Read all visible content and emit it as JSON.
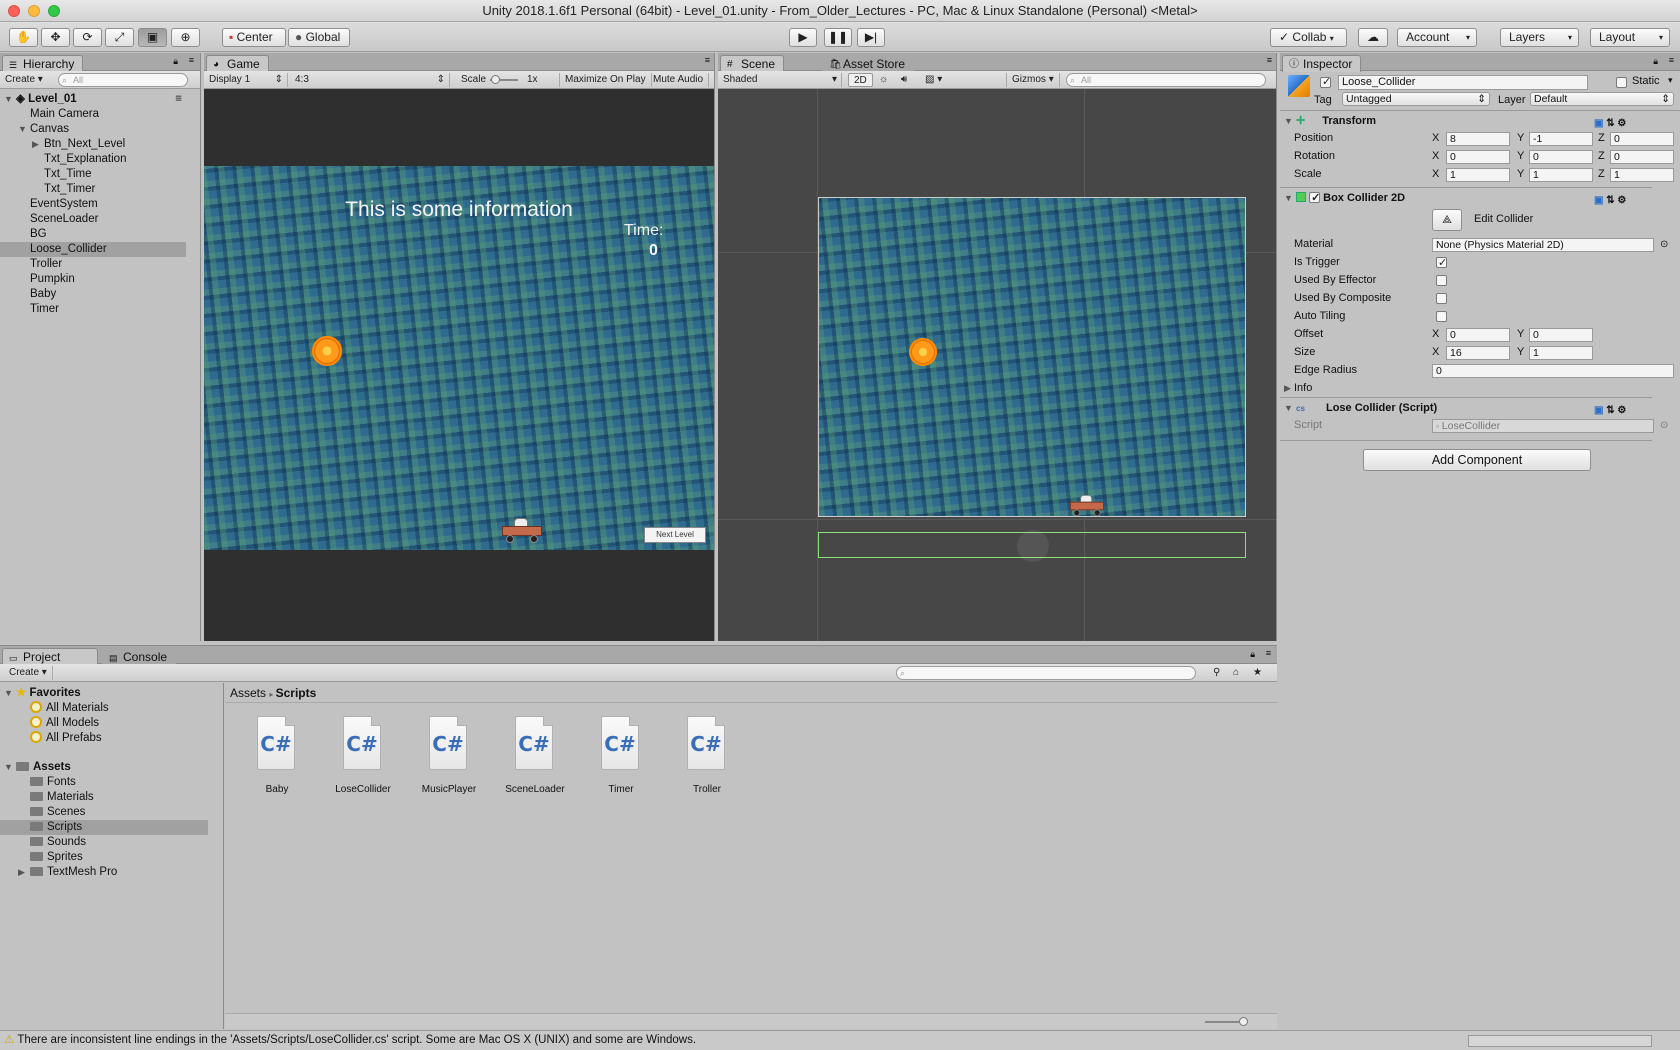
{
  "window": {
    "title": "Unity 2018.1.6f1 Personal (64bit) - Level_01.unity - From_Older_Lectures - PC, Mac & Linux Standalone (Personal) <Metal>"
  },
  "toolbar": {
    "center_label": "Center",
    "global_label": "Global",
    "collab_label": "Collab",
    "account_label": "Account",
    "layers_label": "Layers",
    "layout_label": "Layout"
  },
  "hierarchy": {
    "tab": "Hierarchy",
    "create": "Create",
    "search_placeholder": "All",
    "scene": "Level_01",
    "items": [
      "Main Camera",
      "Canvas",
      "Btn_Next_Level",
      "Txt_Explanation",
      "Txt_Time",
      "Txt_Timer",
      "EventSystem",
      "SceneLoader",
      "BG",
      "Loose_Collider",
      "Troller",
      "Pumpkin",
      "Baby",
      "Timer"
    ]
  },
  "game": {
    "tab": "Game",
    "display": "Display 1",
    "aspect": "4:3",
    "scale_label": "Scale",
    "scale_value": "1x",
    "maximize": "Maximize On Play",
    "mute": "Mute Audio",
    "info_text": "This is some information",
    "time_label": "Time:",
    "time_value": "0",
    "next_level": "Next Level"
  },
  "scene": {
    "tab": "Scene",
    "asset_store_tab": "Asset Store",
    "shading": "Shaded",
    "mode_2d": "2D",
    "gizmos": "Gizmos",
    "search_placeholder": "All"
  },
  "inspector": {
    "tab": "Inspector",
    "object_name": "Loose_Collider",
    "static_label": "Static",
    "tag_label": "Tag",
    "tag_value": "Untagged",
    "layer_label": "Layer",
    "layer_value": "Default",
    "transform": {
      "title": "Transform",
      "rows": [
        {
          "label": "Position",
          "x": "8",
          "y": "-1",
          "z": "0"
        },
        {
          "label": "Rotation",
          "x": "0",
          "y": "0",
          "z": "0"
        },
        {
          "label": "Scale",
          "x": "1",
          "y": "1",
          "z": "1"
        }
      ]
    },
    "box_collider": {
      "title": "Box Collider 2D",
      "edit_collider": "Edit Collider",
      "material_label": "Material",
      "material_value": "None (Physics Material 2D)",
      "is_trigger": "Is Trigger",
      "used_by_effector": "Used By Effector",
      "used_by_composite": "Used By Composite",
      "auto_tiling": "Auto Tiling",
      "offset_label": "Offset",
      "offset_x": "0",
      "offset_y": "0",
      "size_label": "Size",
      "size_x": "16",
      "size_y": "1",
      "edge_radius_label": "Edge Radius",
      "edge_radius_value": "0",
      "info_label": "Info"
    },
    "script_comp": {
      "title": "Lose Collider (Script)",
      "script_label": "Script",
      "script_value": "LoseCollider"
    },
    "add_component": "Add Component"
  },
  "project": {
    "tab": "Project",
    "console_tab": "Console",
    "create": "Create",
    "favorites_label": "Favorites",
    "favorites": [
      "All Materials",
      "All Models",
      "All Prefabs"
    ],
    "assets_label": "Assets",
    "folders": [
      "Fonts",
      "Materials",
      "Scenes",
      "Scripts",
      "Sounds",
      "Sprites",
      "TextMesh Pro"
    ],
    "breadcrumb_root": "Assets",
    "breadcrumb_current": "Scripts",
    "files": [
      "Baby",
      "LoseCollider",
      "MusicPlayer",
      "SceneLoader",
      "Timer",
      "Troller"
    ],
    "cs_glyph": "C#"
  },
  "status": {
    "message": "There are inconsistent line endings in the 'Assets/Scripts/LoseCollider.cs' script. Some are Mac OS X (UNIX) and some are Windows."
  }
}
